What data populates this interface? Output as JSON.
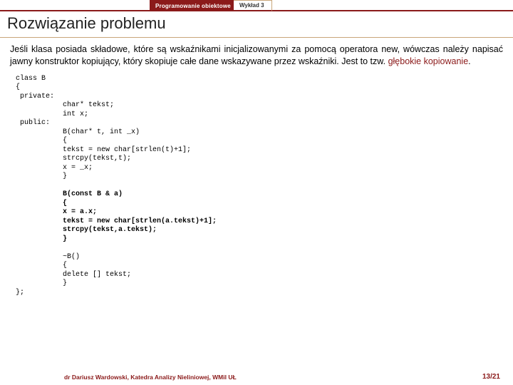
{
  "header": {
    "course_title": "Programowanie obiektowe",
    "lecture_tag": "Wykład 3"
  },
  "slide_title": "Rozwiązanie problemu",
  "paragraph": {
    "text_before": "Jeśli klasa posiada składowe, które są wskaźnikami inicjalizowanymi za pomocą operatora new, wówczas należy napisać jawny konstruktor kopiujący, który skopiuje całe dane wskazywane przez wskaźniki. Jest to tzw. ",
    "highlight": "głębokie kopiowanie",
    "text_after": "."
  },
  "code": {
    "part1": "class B\n{\n private:\n           char* tekst;\n           int x;\n public:\n           B(char* t, int _x)\n           {\n           tekst = new char[strlen(t)+1];\n           strcpy(tekst,t);\n           x = _x;\n           }\n",
    "part2_bold": "\n           B(const B & a)\n           {\n           x = a.x;\n           tekst = new char[strlen(a.tekst)+1];\n           strcpy(tekst,a.tekst);\n           }\n",
    "part3": "\n           ~B()\n           {\n           delete [] tekst;\n           }\n};"
  },
  "footer": {
    "author": "dr Dariusz Wardowski, Katedra Analizy Nieliniowej, WMiI UŁ",
    "pagenum": "13/21"
  }
}
